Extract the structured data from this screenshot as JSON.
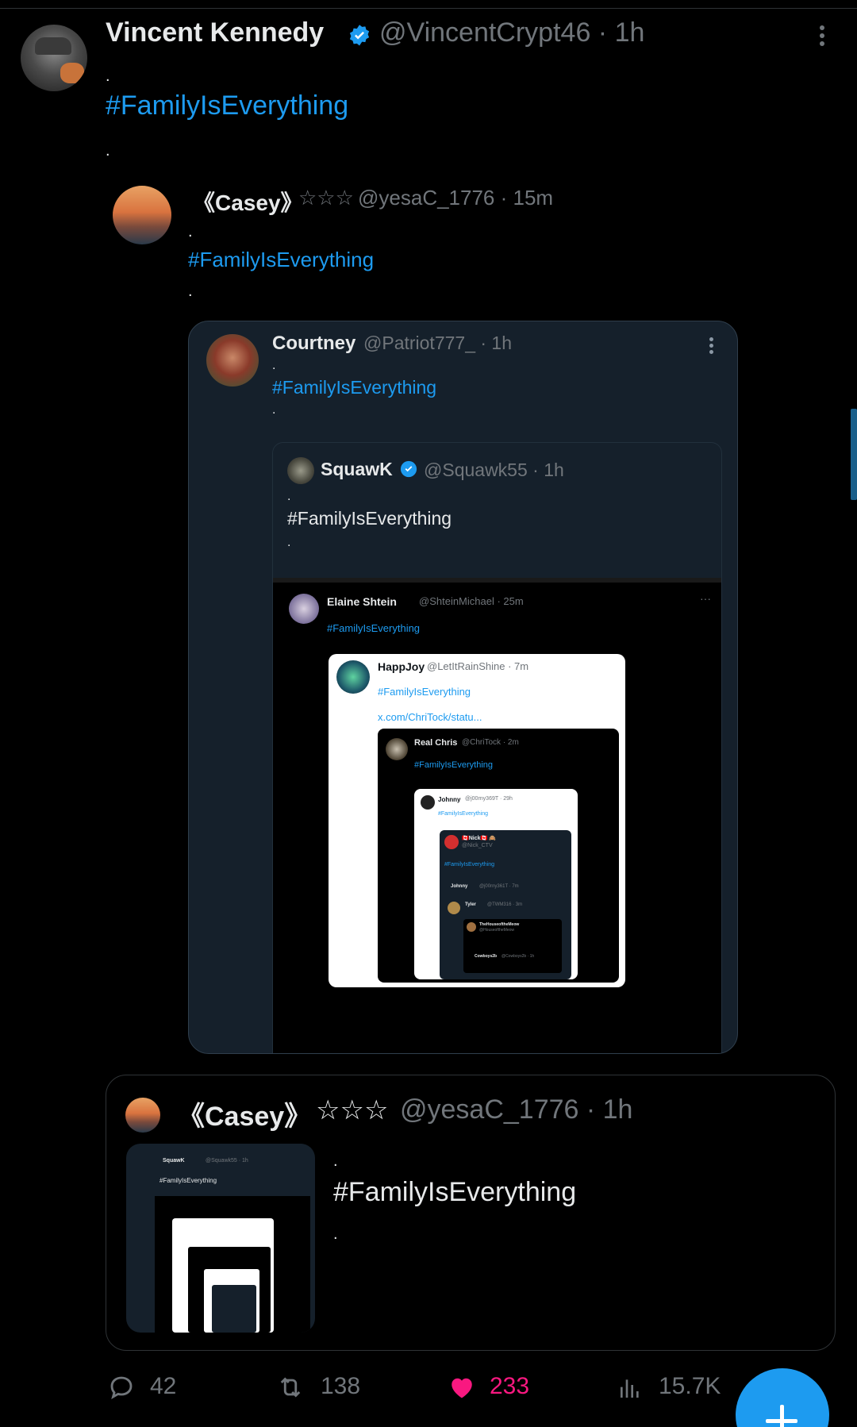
{
  "main": {
    "name": "Vincent Kennedy",
    "handle": "@VincentCrypt46 · 1h",
    "dot": ".",
    "hashtag": "#FamilyIsEverything"
  },
  "reply_casey": {
    "name": "《Casey》",
    "stars": "☆☆☆",
    "handle": "@yesaC_1776 · 15m",
    "hashtag": "#FamilyIsEverything"
  },
  "image_tweet": {
    "courtney": {
      "name": "Courtney",
      "handle": "@Patriot777_ · 1h",
      "hashtag": "#FamilyIsEverything"
    },
    "squawk": {
      "name": "SquawK",
      "handle": "@Squawk55 · 1h",
      "hashtag": "#FamilyIsEverything"
    },
    "elaine": {
      "name": "Elaine Shtein",
      "handle": "@ShteinMichael · 25m",
      "hashtag": "#FamilyIsEverything"
    },
    "happjoy": {
      "name": "HappJoy",
      "handle": "@LetItRainShine · 7m",
      "hashtag": "#FamilyIsEverything",
      "link": "x.com/ChriTock/statu..."
    },
    "realchris": {
      "name": "Real Chris",
      "handle": "@ChriTock · 2m",
      "hashtag": "#FamilyIsEverything"
    },
    "johnny": {
      "name": "Johnny",
      "handle": "@j00rny369T · 29h",
      "hashtag": "#FamilyIsEverything"
    },
    "nick": {
      "name": "🇨🇦Nick🇨🇦 🙈",
      "handle": "@Nick_CTV",
      "hashtag": "#FamilyIsEverything"
    },
    "johnny2": {
      "name": "Johnny",
      "handle": "@j00rny361T · 7m"
    },
    "tyler": {
      "name": "Tyler",
      "handle": "@TWM316 · 3m"
    },
    "hmm": {
      "name": "TheHouseoftheMeow",
      "handle": "@HouseoftheMeow"
    },
    "cowboys": {
      "name": "Cowboys2b",
      "handle": "@Cowboys2b · 1h"
    }
  },
  "quote_card": {
    "name": "《Casey》",
    "stars": "☆☆☆",
    "handle": "@yesaC_1776 · 1h",
    "hashtag": "#FamilyIsEverything",
    "thumb_squawk": "SquawK",
    "thumb_handle": "@Squawk55 · 1h",
    "thumb_tag": "#FamilyIsEverything"
  },
  "actions": {
    "replies": "42",
    "reposts": "138",
    "likes": "233",
    "views": "15.7K"
  },
  "colors": {
    "accent": "#1d9bf0",
    "like": "#f91880",
    "muted": "#71767b"
  }
}
